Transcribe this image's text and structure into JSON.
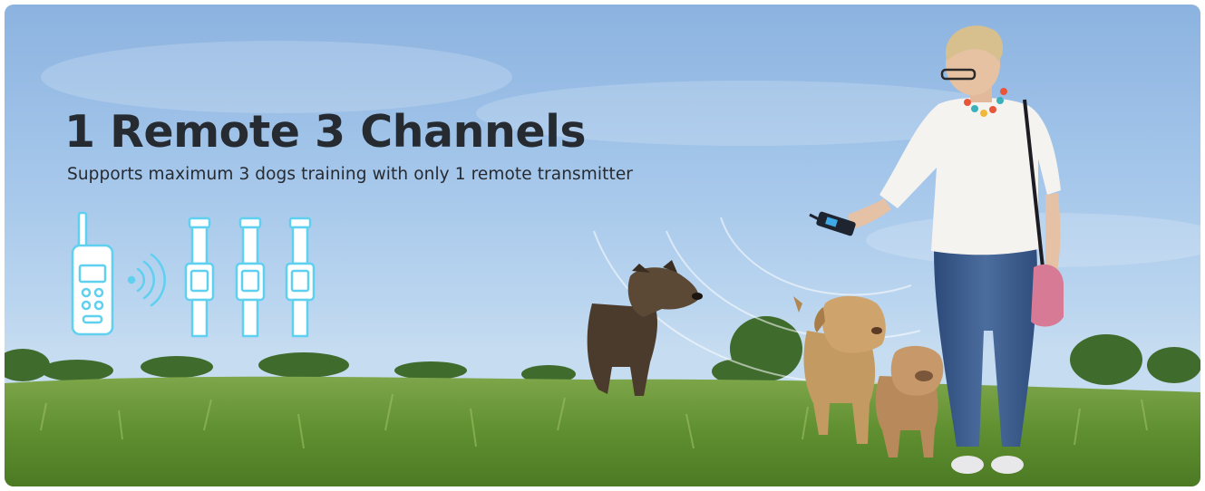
{
  "banner": {
    "headline": "1 Remote 3 Channels",
    "subline": "Supports maximum 3 dogs training with only 1 remote transmitter"
  },
  "icons": {
    "transmitter": "remote-transmitter-icon",
    "signal": "wireless-signal-icon",
    "collars": [
      "dog-collar-icon",
      "dog-collar-icon",
      "dog-collar-icon"
    ]
  },
  "colors": {
    "headline_text": "#262a31",
    "icon_outline": "#5fd0f0",
    "sky": "#a4c6ea",
    "grass": "#6f9e3c"
  }
}
